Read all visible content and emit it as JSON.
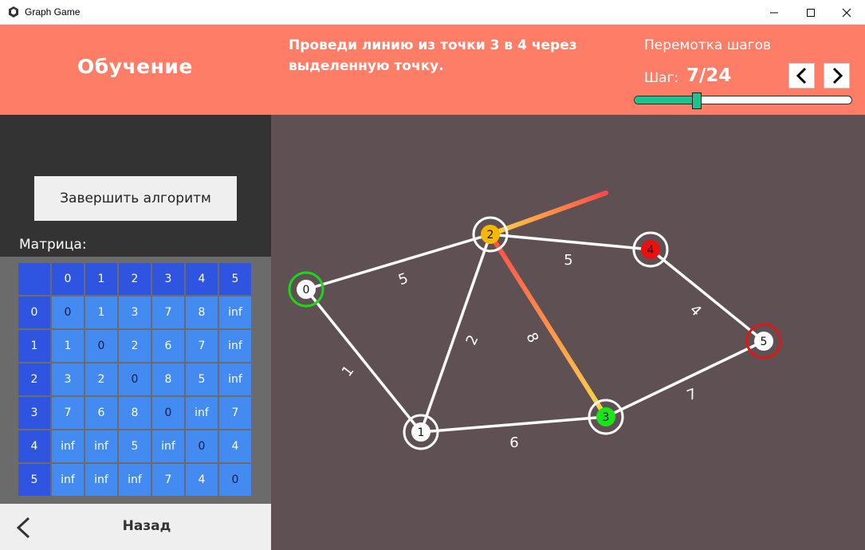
{
  "window": {
    "title": "Graph Game",
    "minimize_icon": "minimize-icon",
    "maximize_icon": "maximize-icon",
    "close_icon": "close-icon"
  },
  "header": {
    "mode_title": "Обучение",
    "instruction": "Проведи линию из точки 3 в 4 через выделенную точку.",
    "rewind_label": "Перемотка шагов",
    "step_label": "Шаг:",
    "step_value": "7/24",
    "step_progress": 0.29,
    "prev_icon": "chevron-left-icon",
    "next_icon": "chevron-right-icon",
    "accent_color": "#fe7d67",
    "slider_color": "#1ec28f"
  },
  "sidebar": {
    "finish_button": "Завершить алгоритм",
    "matrix_label": "Матрица:",
    "matrix": {
      "headers": [
        "0",
        "1",
        "2",
        "3",
        "4",
        "5"
      ],
      "rows": [
        {
          "label": "0",
          "values": [
            "0",
            "1",
            "3",
            "7",
            "8",
            "inf"
          ]
        },
        {
          "label": "1",
          "values": [
            "1",
            "0",
            "2",
            "6",
            "7",
            "inf"
          ]
        },
        {
          "label": "2",
          "values": [
            "3",
            "2",
            "0",
            "8",
            "5",
            "inf"
          ]
        },
        {
          "label": "3",
          "values": [
            "7",
            "6",
            "8",
            "0",
            "inf",
            "7"
          ]
        },
        {
          "label": "4",
          "values": [
            "inf",
            "inf",
            "5",
            "inf",
            "0",
            "4"
          ]
        },
        {
          "label": "5",
          "values": [
            "inf",
            "inf",
            "inf",
            "7",
            "4",
            "0"
          ]
        }
      ]
    },
    "back_label": "Назад",
    "back_icon": "chevron-left-icon"
  },
  "graph": {
    "nodes": [
      {
        "id": "0",
        "fill": "#ffffff",
        "ring": "#1cd61c"
      },
      {
        "id": "1",
        "fill": "#ffffff",
        "ring": "#ffffff"
      },
      {
        "id": "2",
        "fill": "#f5b800",
        "ring": "#ffffff"
      },
      {
        "id": "3",
        "fill": "#19e619",
        "ring": "#ffffff"
      },
      {
        "id": "4",
        "fill": "#e81010",
        "ring": "#ffffff"
      },
      {
        "id": "5",
        "fill": "#ffffff",
        "ring": "#d91a1a"
      }
    ],
    "edges": [
      {
        "from": "0",
        "to": "2",
        "weight": "5"
      },
      {
        "from": "0",
        "to": "1",
        "weight": "1"
      },
      {
        "from": "1",
        "to": "2",
        "weight": "2"
      },
      {
        "from": "1",
        "to": "3",
        "weight": "6"
      },
      {
        "from": "2",
        "to": "4",
        "weight": "5"
      },
      {
        "from": "2",
        "to": "3",
        "weight": "8"
      },
      {
        "from": "4",
        "to": "5",
        "weight": "4"
      },
      {
        "from": "3",
        "to": "5",
        "weight": "7"
      }
    ],
    "highlight_color_start": "#ff4a4a",
    "highlight_color_end": "#ffd84a"
  }
}
